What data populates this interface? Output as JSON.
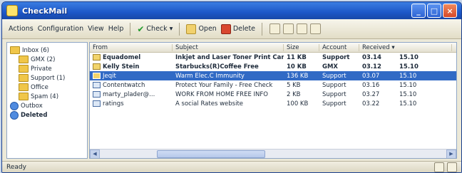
{
  "window": {
    "title": "CheckMail"
  },
  "menu": [
    {
      "label": "Actions"
    },
    {
      "label": "Configuration"
    },
    {
      "label": "View"
    },
    {
      "label": "Help"
    }
  ],
  "toolbar": {
    "check_label": "Check ▾",
    "open_label": "Open",
    "delete_label": "Delete"
  },
  "tree": [
    {
      "label": "Inbox (6)",
      "level": 0,
      "icon": "folder-icon"
    },
    {
      "label": "GMX (2)",
      "level": 1,
      "icon": "folder-icon"
    },
    {
      "label": "Private",
      "level": 1,
      "icon": "folder-icon"
    },
    {
      "label": "Support (1)",
      "level": 1,
      "icon": "folder-icon"
    },
    {
      "label": "Office",
      "level": 1,
      "icon": "folder-icon"
    },
    {
      "label": "Spam (4)",
      "level": 1,
      "icon": "folder-icon"
    },
    {
      "label": "Outbox",
      "level": 0,
      "icon": "globe-icon"
    },
    {
      "label": "Deleted",
      "level": 0,
      "icon": "globe-icon",
      "bold": true
    }
  ],
  "columns": {
    "from": "From",
    "subject": "Subject",
    "size": "Size",
    "account": "Account",
    "received": "Received ▾"
  },
  "messages": [
    {
      "from": "Equadomel",
      "subject": "Inkjet and Laser Toner Print Cartr...",
      "size": "11 KB",
      "account": "Support",
      "date": "03.14",
      "time": "15.10",
      "unread": true,
      "selected": false
    },
    {
      "from": "Kelly Stein",
      "subject": "Starbucks(R)Coffee Free",
      "size": "10 KB",
      "account": "GMX",
      "date": "03.12",
      "time": "15.10",
      "unread": true,
      "selected": false
    },
    {
      "from": "Jeqit",
      "subject": "Warm Elec.C Immunity",
      "size": "136 KB",
      "account": "Support",
      "date": "03.07",
      "time": "15.10",
      "unread": false,
      "selected": true
    },
    {
      "from": "Contentwatch",
      "subject": "Protect Your Family - Free Check",
      "size": "5 KB",
      "account": "Support",
      "date": "03.16",
      "time": "15.10",
      "unread": false,
      "selected": false
    },
    {
      "from": "marty_plader@...",
      "subject": "WORK FROM HOME FREE INFO",
      "size": "2 KB",
      "account": "Support",
      "date": "03.27",
      "time": "15.10",
      "unread": false,
      "selected": false
    },
    {
      "from": "ratings",
      "subject": "A social Rates website",
      "size": "100 KB",
      "account": "Support",
      "date": "03.22",
      "time": "15.10",
      "unread": false,
      "selected": false
    }
  ],
  "status": {
    "text": "Ready"
  }
}
